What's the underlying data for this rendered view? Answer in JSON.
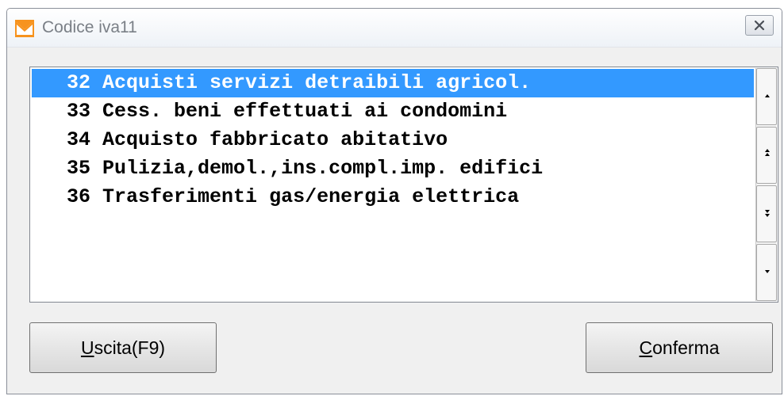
{
  "window": {
    "title": "Codice iva11",
    "icon": "app-logo-icon",
    "close_icon": "close-icon"
  },
  "list": {
    "items": [
      {
        "code": "32",
        "label": "Acquisti servizi detraibili agricol.",
        "selected": true
      },
      {
        "code": "33",
        "label": "Cess. beni effettuati ai condomini",
        "selected": false
      },
      {
        "code": "34",
        "label": "Acquisto fabbricato abitativo",
        "selected": false
      },
      {
        "code": "35",
        "label": "Pulizia,demol.,ins.compl.imp. edifici",
        "selected": false
      },
      {
        "code": "36",
        "label": "Trasferimenti gas/energia elettrica",
        "selected": false
      }
    ],
    "scrollbar_buttons": [
      "line-up-icon",
      "page-up-icon",
      "page-down-icon",
      "line-down-icon"
    ]
  },
  "buttons": {
    "exit": {
      "accel": "U",
      "rest": "scita(F9)"
    },
    "confirm": {
      "accel": "C",
      "rest": "onferma"
    }
  },
  "colors": {
    "selection": "#3399ff",
    "window_bg": "#f0f0f0",
    "title_text": "#7a7f86"
  }
}
